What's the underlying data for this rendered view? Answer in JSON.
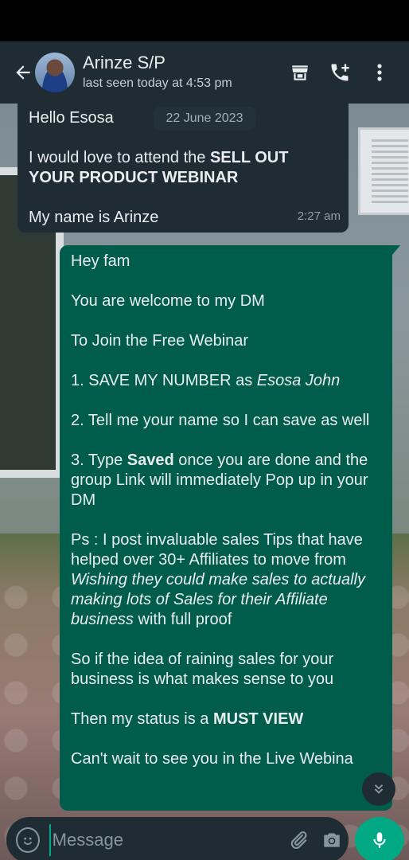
{
  "header": {
    "contact_name": "Arinze S/P",
    "last_seen": "last seen today at 4:53 pm"
  },
  "icons": {
    "back": "arrow-left-icon",
    "shop": "storefront-icon",
    "call": "add-call-icon",
    "menu": "more-vert-icon",
    "emoji": "emoji-icon",
    "attach": "paperclip-icon",
    "camera": "camera-icon",
    "mic": "mic-icon",
    "scroll": "chevron-double-down-icon"
  },
  "colors": {
    "header_bg": "#1f2c34",
    "incoming_bubble": "#1f2c34",
    "outgoing_bubble": "#005c4b",
    "accent": "#00a884"
  },
  "chat": {
    "date_chip": "22 June 2023",
    "incoming": {
      "greeting": "Hello Esosa",
      "line2_prefix": "I would love to attend the ",
      "line2_bold": "SELL OUT YOUR PRODUCT WEBINAR",
      "line3": "My name is Arinze",
      "time": "2:27 am"
    },
    "outgoing": {
      "p1": "Hey fam",
      "p2": "You are welcome to my DM",
      "p3": "To Join the Free Webinar",
      "p4_prefix": "1. SAVE MY NUMBER as ",
      "p4_italic": "Esosa John",
      "p5": "2. Tell me your name so I can save as well",
      "p6_prefix": "3. Type ",
      "p6_bold": "Saved",
      "p6_suffix": " once you are done and the group Link will immediately Pop up in your DM",
      "p7_prefix": "Ps : I post invaluable sales Tips that have helped over 30+ Affiliates to move from ",
      "p7_italic": "Wishing they could make sales to actually making lots of Sales for their Affiliate business",
      "p7_suffix": "  with full proof",
      "p8": "So if the idea of raining sales for your business is what makes sense to you",
      "p9_prefix": "Then my status is a ",
      "p9_bold": "MUST VIEW",
      "p10": "Can't wait to see you in the Live Webina"
    }
  },
  "composer": {
    "placeholder": "Message"
  }
}
